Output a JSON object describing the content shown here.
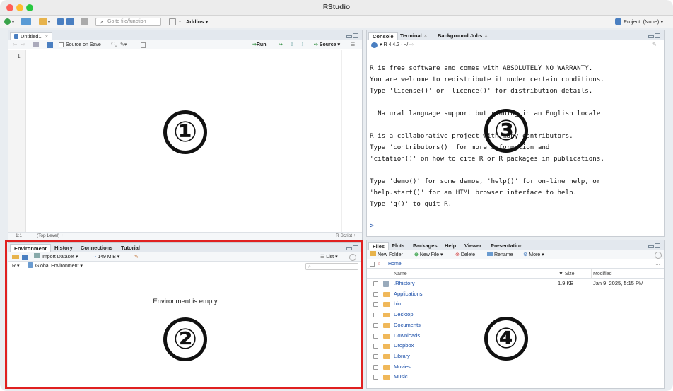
{
  "window": {
    "title": "RStudio"
  },
  "toolbar": {
    "goto_placeholder": "Go to file/function",
    "addins": "Addins",
    "project": "Project: (None)"
  },
  "source": {
    "tab": "Untitled1",
    "source_on_save": "Source on Save",
    "run": "Run",
    "source": "Source",
    "line_number": "1",
    "status_pos": "1:1",
    "status_level": "(Top Level) ÷",
    "status_type": "R Script ÷"
  },
  "env": {
    "tabs": [
      "Environment",
      "History",
      "Connections",
      "Tutorial"
    ],
    "import_dataset": "Import Dataset",
    "memory": "149 MiB",
    "list": "List",
    "r": "R",
    "global_env": "Global Environment",
    "empty_text": "Environment is empty"
  },
  "console": {
    "tabs": [
      "Console",
      "Terminal",
      "Background Jobs"
    ],
    "version": "R 4.4.2",
    "path": "~/",
    "lines": [
      "R is free software and comes with ABSOLUTELY NO WARRANTY.",
      "You are welcome to redistribute it under certain conditions.",
      "Type 'license()' or 'licence()' for distribution details.",
      "",
      "  Natural language support but running in an English locale",
      "",
      "R is a collaborative project with many contributors.",
      "Type 'contributors()' for more information and",
      "'citation()' on how to cite R or R packages in publications.",
      "",
      "Type 'demo()' for some demos, 'help()' for on-line help, or",
      "'help.start()' for an HTML browser interface to help.",
      "Type 'q()' to quit R."
    ],
    "prompt": ">"
  },
  "files": {
    "tabs": [
      "Files",
      "Plots",
      "Packages",
      "Help",
      "Viewer",
      "Presentation"
    ],
    "new_folder": "New Folder",
    "new_file": "New File",
    "delete": "Delete",
    "rename": "Rename",
    "more": "More",
    "breadcrumb": "Home",
    "col_name": "Name",
    "col_size": "Size",
    "col_modified": "Modified",
    "rows": [
      {
        "name": ".Rhistory",
        "size": "1.9 KB",
        "modified": "Jan 9, 2025, 5:15 PM"
      },
      {
        "name": "Applications",
        "size": "",
        "modified": ""
      },
      {
        "name": "bin",
        "size": "",
        "modified": ""
      },
      {
        "name": "Desktop",
        "size": "",
        "modified": ""
      },
      {
        "name": "Documents",
        "size": "",
        "modified": ""
      },
      {
        "name": "Downloads",
        "size": "",
        "modified": ""
      },
      {
        "name": "Dropbox",
        "size": "",
        "modified": ""
      },
      {
        "name": "Library",
        "size": "",
        "modified": ""
      },
      {
        "name": "Movies",
        "size": "",
        "modified": ""
      },
      {
        "name": "Music",
        "size": "",
        "modified": ""
      }
    ]
  },
  "annotations": {
    "one": "①",
    "two": "②",
    "three": "③",
    "four": "④"
  },
  "colors": {
    "highlight_box": "#e02020",
    "traffic_red": "#ff5f57",
    "traffic_yellow": "#febc2e",
    "traffic_green": "#28c840",
    "link": "#1a4ea8"
  }
}
